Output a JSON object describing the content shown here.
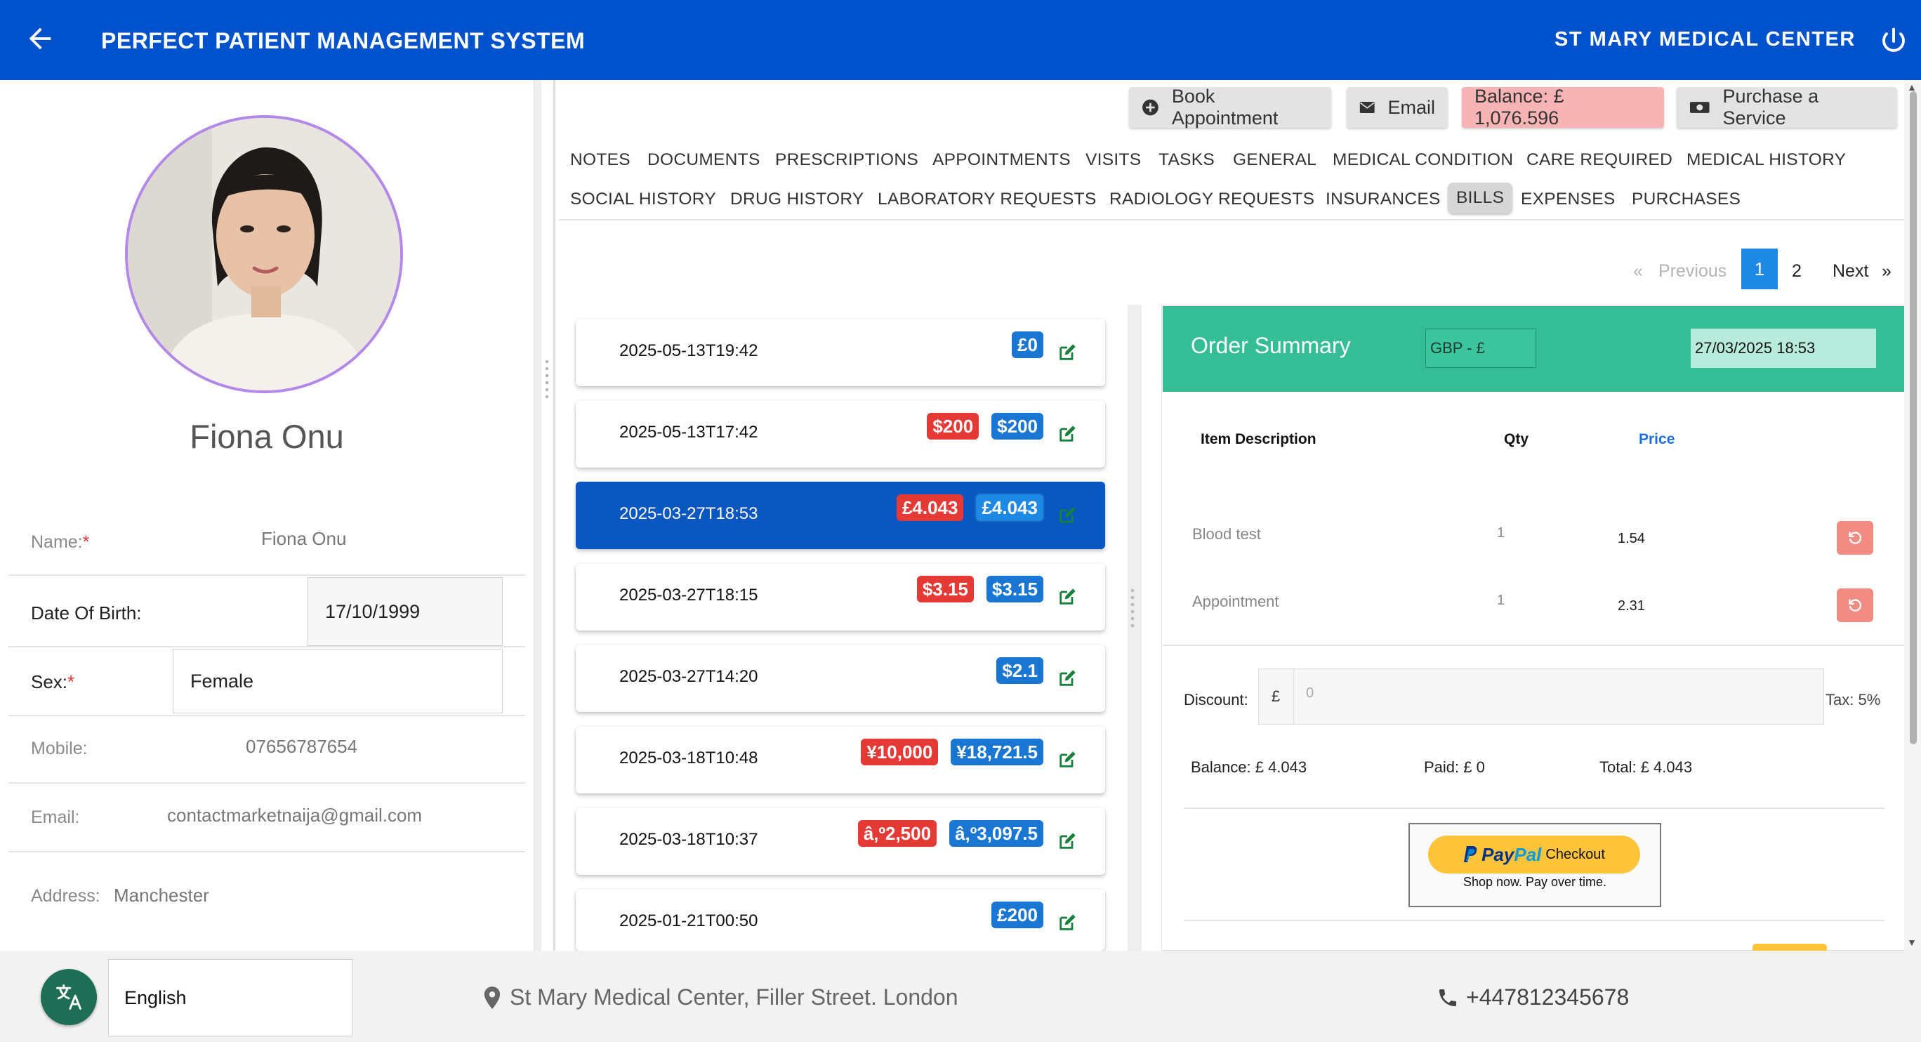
{
  "header": {
    "title": "PERFECT PATIENT MANAGEMENT SYSTEM",
    "center": "ST MARY MEDICAL CENTER",
    "color": "#0052cc"
  },
  "patient": {
    "name": "Fiona Onu",
    "fields": {
      "name_label": "Name:",
      "name_value": "Fiona Onu",
      "dob_label": "Date Of Birth:",
      "dob_value": "17/10/1999",
      "sex_label": "Sex:",
      "sex_value": "Female",
      "mobile_label": "Mobile:",
      "mobile_value": "07656787654",
      "email_label": "Email:",
      "email_value": "contactmarketnaija@gmail.com",
      "address_label": "Address:",
      "address_value": "Manchester"
    },
    "required_mark": "*"
  },
  "actions": {
    "book": "Book Appointment",
    "email": "Email",
    "balance": "Balance: £ 1,076.596",
    "purchase": "Purchase a Service"
  },
  "tabs": {
    "row1": [
      "NOTES",
      "DOCUMENTS",
      "PRESCRIPTIONS",
      "APPOINTMENTS",
      "VISITS",
      "TASKS",
      "GENERAL",
      "MEDICAL CONDITION",
      "CARE REQUIRED",
      "MEDICAL HISTORY"
    ],
    "row2": [
      "SOCIAL HISTORY",
      "DRUG HISTORY",
      "LABORATORY REQUESTS",
      "RADIOLOGY REQUESTS",
      "INSURANCES",
      "BILLS",
      "EXPENSES",
      "PURCHASES"
    ],
    "active": "BILLS"
  },
  "pagination": {
    "prev_arrow": "«",
    "prev": "Previous",
    "current": "1",
    "page2": "2",
    "next": "Next",
    "next_arrow": "»"
  },
  "bills": [
    {
      "date": "2025-05-13T19:42",
      "paid": "",
      "total": "£0"
    },
    {
      "date": "2025-05-13T17:42",
      "paid": "$200",
      "total": "$200"
    },
    {
      "date": "2025-03-27T18:53",
      "paid": "£4.043",
      "total": "£4.043",
      "active": true
    },
    {
      "date": "2025-03-27T18:15",
      "paid": "$3.15",
      "total": "$3.15"
    },
    {
      "date": "2025-03-27T14:20",
      "paid": "",
      "total": "$2.1"
    },
    {
      "date": "2025-03-18T10:48",
      "paid": "¥10,000",
      "total": "¥18,721.5"
    },
    {
      "date": "2025-03-18T10:37",
      "paid": "â‚º2,500",
      "total": "â‚º3,097.5"
    },
    {
      "date": "2025-01-21T00:50",
      "paid": "",
      "total": "£200"
    }
  ],
  "summary": {
    "title": "Order Summary",
    "currency": "GBP - £",
    "datetime": "27/03/2025  18:53",
    "col_item": "Item Description",
    "col_qty": "Qty",
    "col_price": "Price",
    "items": [
      {
        "name": "Blood test",
        "qty": "1",
        "price": "1.54"
      },
      {
        "name": "Appointment",
        "qty": "1",
        "price": "2.31"
      }
    ],
    "discount_label": "Discount:",
    "discount_symbol": "£",
    "discount_value": "0",
    "tax": "Tax: 5%",
    "balance": "Balance: £ 4.043",
    "paid": "Paid: £ 0",
    "total": "Total: £ 4.043",
    "paypal_p1": "Pay",
    "paypal_p2": "Pal",
    "paypal_checkout": "Checkout",
    "paypal_tagline": "Shop now. Pay over time."
  },
  "footer": {
    "language": "English",
    "address": "St Mary Medical Center, Filler Street. London",
    "phone": "+447812345678"
  }
}
